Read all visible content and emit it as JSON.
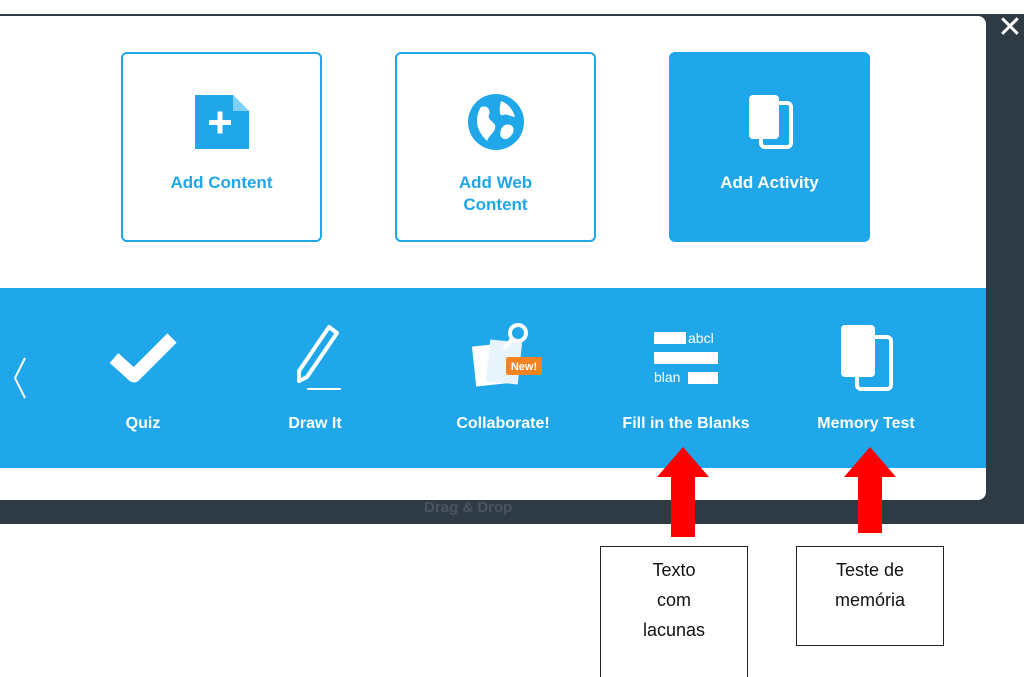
{
  "window": {
    "close_symbol": "✕"
  },
  "cards": [
    {
      "id": "add-content",
      "label": "Add Content",
      "icon": "file-plus-icon",
      "active": false
    },
    {
      "id": "add-web-content",
      "label": "Add Web Content",
      "icon": "globe-icon",
      "active": false
    },
    {
      "id": "add-activity",
      "label": "Add Activity",
      "icon": "copy-cards-icon",
      "active": true
    }
  ],
  "activities": [
    {
      "id": "quiz",
      "label": "Quiz",
      "icon": "checkmark-icon"
    },
    {
      "id": "draw-it",
      "label": "Draw It",
      "icon": "pencil-icon"
    },
    {
      "id": "collaborate",
      "label": "Collaborate!",
      "icon": "collaborate-icon",
      "badge": "New!"
    },
    {
      "id": "fill-in-the-blanks",
      "label": "Fill in the Blanks",
      "icon": "fill-blanks-icon",
      "icon_text": [
        "abcl",
        "blan"
      ]
    },
    {
      "id": "memory-test",
      "label": "Memory Test",
      "icon": "memory-cards-icon"
    }
  ],
  "partially_hidden": {
    "label": "Drag & Drop"
  },
  "annotations": [
    {
      "target": "fill-in-the-blanks",
      "lines": [
        "Texto",
        "com",
        "lacunas"
      ]
    },
    {
      "target": "memory-test",
      "lines": [
        "Teste de",
        "memória"
      ]
    }
  ],
  "colors": {
    "accent": "#1fa7ea",
    "backdrop": "#2e3a44",
    "arrow": "#ff0000"
  }
}
